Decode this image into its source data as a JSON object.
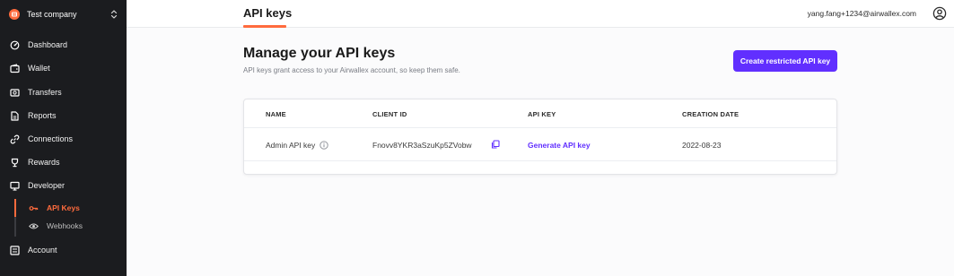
{
  "sidebar": {
    "company": "Test company",
    "items": [
      {
        "label": "Dashboard",
        "icon": "dashboard-icon"
      },
      {
        "label": "Wallet",
        "icon": "wallet-icon"
      },
      {
        "label": "Transfers",
        "icon": "transfers-icon"
      },
      {
        "label": "Reports",
        "icon": "reports-icon"
      },
      {
        "label": "Connections",
        "icon": "connections-icon"
      },
      {
        "label": "Rewards",
        "icon": "rewards-icon"
      },
      {
        "label": "Developer",
        "icon": "developer-icon"
      }
    ],
    "sub_items": [
      {
        "label": "API Keys",
        "icon": "key-icon",
        "active": true
      },
      {
        "label": "Webhooks",
        "icon": "eye-icon",
        "active": false
      }
    ],
    "account": {
      "label": "Account",
      "icon": "account-icon"
    }
  },
  "header": {
    "tab": "API keys",
    "email": "yang.fang+1234@airwallex.com"
  },
  "main": {
    "title": "Manage your API keys",
    "subtitle": "API keys grant access to your Airwallex account, so keep them safe.",
    "create_button": "Create restricted API key",
    "table": {
      "columns": [
        "NAME",
        "CLIENT ID",
        "API KEY",
        "CREATION DATE"
      ],
      "rows": [
        {
          "name": "Admin API key",
          "client_id": "Fnovv8YKR3aSzuKp5ZVobw",
          "api_key": "Generate API key",
          "created": "2022-08-23"
        }
      ]
    }
  },
  "colors": {
    "accent": "#ff6b3d",
    "primary": "#612fff",
    "sidebar_bg": "#1b1c1f"
  }
}
